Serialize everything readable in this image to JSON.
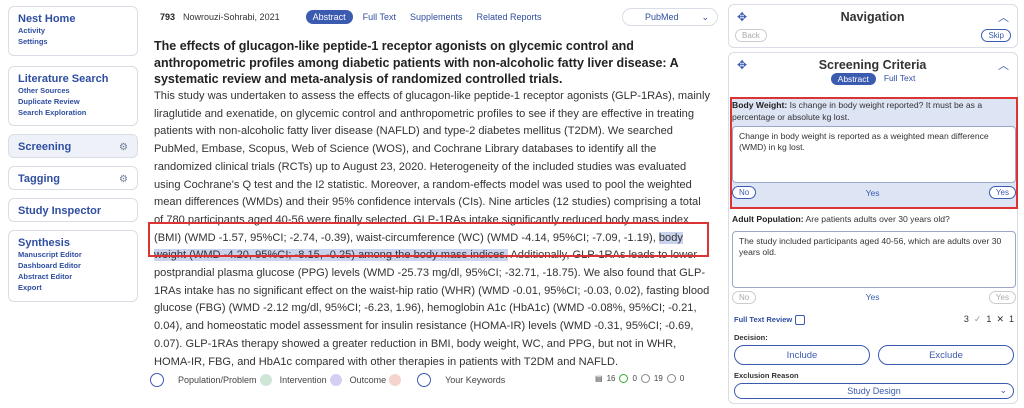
{
  "sidebar": {
    "nest_home": {
      "title": "Nest Home",
      "items": [
        "Activity",
        "Settings"
      ]
    },
    "literature_search": {
      "title": "Literature Search",
      "items": [
        "Other Sources",
        "Duplicate Review",
        "Search Exploration"
      ]
    },
    "screening": {
      "title": "Screening"
    },
    "tagging": {
      "title": "Tagging"
    },
    "study_inspector": {
      "title": "Study Inspector"
    },
    "synthesis": {
      "title": "Synthesis",
      "items": [
        "Manuscript Editor",
        "Dashboard Editor",
        "Abstract Editor",
        "Export"
      ]
    }
  },
  "topbar": {
    "ref_number": "793",
    "ref_author": "Nowrouzi-Sohrabi, 2021",
    "tabs": [
      "Abstract",
      "Full Text",
      "Supplements",
      "Related Reports"
    ],
    "source_select": "PubMed"
  },
  "article": {
    "title": "The effects of glucagon-like peptide-1 receptor agonists on glycemic control and anthropometric profiles among diabetic patients with non-alcoholic fatty liver disease: A systematic review and meta-analysis of randomized controlled trials.",
    "abstract_before": "This study was undertaken to assess the effects of glucagon-like peptide-1 receptor agonists (GLP-1RAs), mainly liraglutide and exenatide, on glycemic control and anthropometric profiles to see if they are effective in treating patients with non-alcoholic fatty liver disease (NAFLD) and type-2 diabetes mellitus (T2DM). We searched PubMed, Embase, Scopus, Web of Science (WOS), and Cochrane Library databases to identify all the randomized clinical trials (RCTs) up to August 23, 2020. Heterogeneity of the included studies was evaluated using Cochrane's Q test and the I2 statistic. Moreover, a random-effects model was used to pool the weighted mean differences (WMDs) and their 95% confidence intervals (CIs). Nine articles (12 studies) comprising a total of 780 participants aged 40-56 were finally selected. GLP-1RAs intake significantly reduced body mass index (BMI) (WMD -1.57, 95%CI; -2.74, -0.39), waist-circumference (WC) (WMD -4.14, 95%CI; -7.09, -1.19), ",
    "abstract_highlight": "body weight (WMD -4.20, 95%CI; -8.15, -0.25) among the body mass indices.",
    "abstract_after": " Additionally, GLP-1RAs leads to lower postprandial plasma glucose (PPG) levels (WMD -25.73 mg/dl, 95%CI; -32.71, -18.75). We also found that GLP-1RAs intake has no significant effect on the waist-hip ratio (WHR) (WMD -0.01, 95%CI; -0.03, 0.02), fasting blood glucose (FBG) (WMD -2.12 mg/dl, 95%CI; -6.23, 1.96), hemoglobin A1c (HbA1c) (WMD -0.08%, 95%CI; -0.21, 0.04), and homeostatic model assessment for insulin resistance (HOMA-IR) levels (WMD -0.31, 95%CI; -0.69, 0.07). GLP-1RAs therapy showed a greater reduction in BMI, body weight, WC, and PPG, but not in WHR, HOMA-IR, FBG, and HbA1c compared with other therapies in patients with T2DM and NAFLD."
  },
  "keywords": {
    "population": "Population/Problem",
    "intervention": "Intervention",
    "outcome": "Outcome",
    "your_keywords": "Your Keywords",
    "stats": {
      "docs": "16",
      "check": "0",
      "excluded": "19",
      "zero": "0"
    },
    "colors": {
      "population": "#cfe6d6",
      "intervention": "#d5d0f2",
      "outcome": "#f5d3cf"
    }
  },
  "navigation": {
    "title": "Navigation",
    "back": "Back",
    "skip": "Skip"
  },
  "screening": {
    "title": "Screening Criteria",
    "tabs": [
      "Abstract",
      "Full Text"
    ],
    "criteria": [
      {
        "label": "Body Weight:",
        "question": "Is change in body weight reported? It must be as a percentage or absolute kg lost.",
        "answer": "Change in body weight is reported as a weighted mean difference (WMD) in kg lost.",
        "no": "No",
        "yes_mid": "Yes",
        "yes": "Yes"
      },
      {
        "label": "Adult Population:",
        "question": "Are patients adults over 30 years old?",
        "answer": "The study included participants aged 40-56, which are adults over 30 years old.",
        "no": "No",
        "yes_mid": "Yes",
        "yes": "Yes"
      }
    ],
    "full_text_review": "Full Text Review",
    "counts": {
      "a": "3",
      "b": "1",
      "c": "1"
    },
    "decision_label": "Decision:",
    "include": "Include",
    "exclude": "Exclude",
    "exclusion_reason_label": "Exclusion Reason",
    "exclusion_reason": "Study Design"
  }
}
